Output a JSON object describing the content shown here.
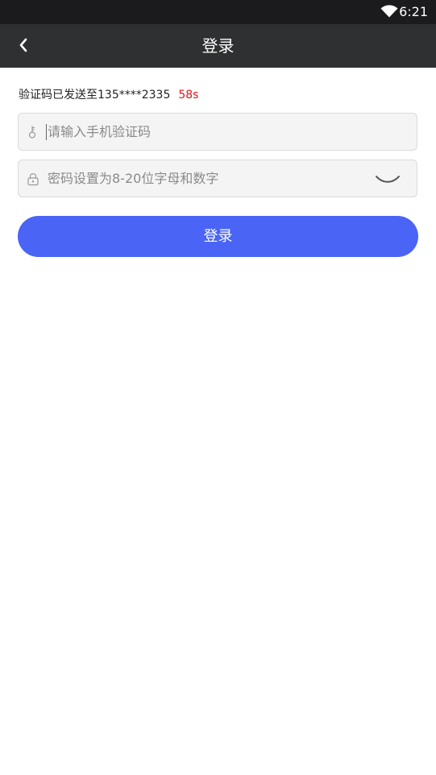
{
  "status_bar": {
    "time": "6:21",
    "wifi_icon": "wifi-icon"
  },
  "nav": {
    "back_icon": "chevron-left-icon",
    "title": "登录"
  },
  "verification": {
    "sent_text": "验证码已发送至135****2335",
    "countdown": "58s"
  },
  "code_field": {
    "icon": "key-icon",
    "placeholder": "请输入手机验证码",
    "value": ""
  },
  "password_field": {
    "icon": "lock-icon",
    "placeholder": "密码设置为8-20位字母和数字",
    "value": "",
    "toggle_icon": "eye-closed-icon"
  },
  "login_button": {
    "label": "登录",
    "color": "#4a64f5"
  },
  "colors": {
    "nav_background": "#2f3032",
    "countdown": "#e8121b"
  }
}
